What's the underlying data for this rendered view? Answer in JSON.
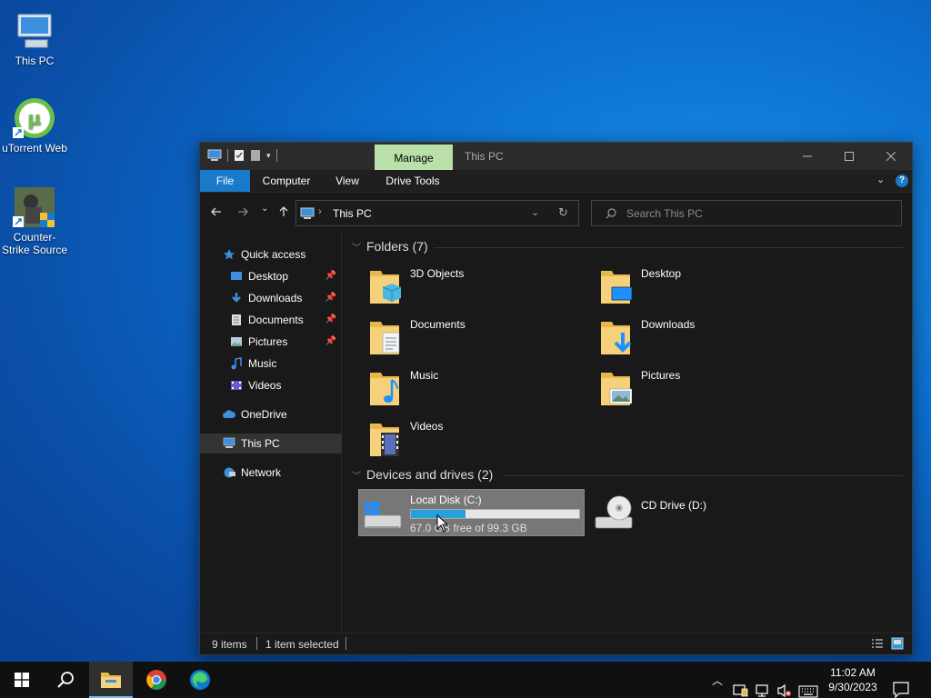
{
  "desktop": {
    "icons": [
      {
        "label": "This PC"
      },
      {
        "label": "uTorrent Web"
      },
      {
        "label": "Counter-Strike Source"
      }
    ]
  },
  "window": {
    "title": "This PC",
    "manage_tab": "Manage",
    "ribbon_tabs": [
      "File",
      "Computer",
      "View",
      "Drive Tools"
    ],
    "address": "This PC",
    "search_placeholder": "Search This PC",
    "nav": {
      "quick_access": "Quick access",
      "items": [
        "Desktop",
        "Downloads",
        "Documents",
        "Pictures",
        "Music",
        "Videos"
      ],
      "onedrive": "OneDrive",
      "this_pc": "This PC",
      "network": "Network"
    },
    "folders_header": "Folders (7)",
    "folders": [
      "3D Objects",
      "Desktop",
      "Documents",
      "Downloads",
      "Music",
      "Pictures",
      "Videos"
    ],
    "drives_header": "Devices and drives (2)",
    "drives": [
      {
        "label": "Local Disk (C:)",
        "free_text": "67.0 GB free of 99.3 GB",
        "used_fraction": 0.325
      },
      {
        "label": "CD Drive (D:)"
      }
    ],
    "status": {
      "items": "9 items",
      "selected": "1 item selected"
    }
  },
  "taskbar": {
    "time": "11:02 AM",
    "date": "9/30/2023"
  },
  "colors": {
    "accent": "#1979ca",
    "manage_tab": "#b8e0a8",
    "drive_fill": "#26a0da"
  }
}
